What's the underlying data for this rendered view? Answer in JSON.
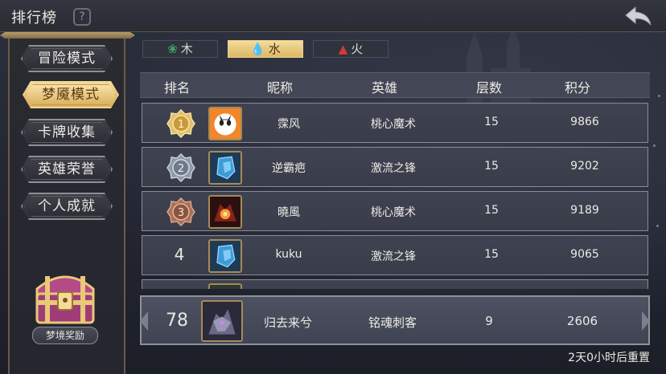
{
  "header": {
    "title": "排行榜"
  },
  "menu": {
    "items": [
      {
        "label": "冒险模式",
        "active": false
      },
      {
        "label": "梦魇模式",
        "active": true
      },
      {
        "label": "卡牌收集",
        "active": false
      },
      {
        "label": "英雄荣誉",
        "active": false
      },
      {
        "label": "个人成就",
        "active": false
      }
    ],
    "reward_label": "梦境奖励"
  },
  "element_tabs": [
    {
      "label": "木",
      "icon": "leaf-icon",
      "active": false
    },
    {
      "label": "水",
      "icon": "water-drop-icon",
      "active": true
    },
    {
      "label": "火",
      "icon": "fire-icon",
      "active": false
    }
  ],
  "table": {
    "headers": [
      "排名",
      "昵称",
      "英雄",
      "层数",
      "积分"
    ],
    "rows": [
      {
        "rank": "1",
        "name": "霂风",
        "hero": "桃心魔术",
        "floor": "15",
        "score": "9866",
        "medal": "gold"
      },
      {
        "rank": "2",
        "name": "逆霸疤",
        "hero": "激流之锋",
        "floor": "15",
        "score": "9202",
        "medal": "silver"
      },
      {
        "rank": "3",
        "name": "曉風",
        "hero": "桃心魔术",
        "floor": "15",
        "score": "9189",
        "medal": "bronze"
      },
      {
        "rank": "4",
        "name": "kuku",
        "hero": "激流之锋",
        "floor": "15",
        "score": "9065",
        "medal": ""
      }
    ],
    "my_row": {
      "rank": "78",
      "name": "归去来兮",
      "hero": "铭魂刺客",
      "floor": "9",
      "score": "2606"
    }
  },
  "footer": {
    "reset_text": "2天0小时后重置"
  },
  "colors": {
    "accent_gold": "#e5c57a",
    "panel": "#3f4351",
    "background": "#262935"
  }
}
